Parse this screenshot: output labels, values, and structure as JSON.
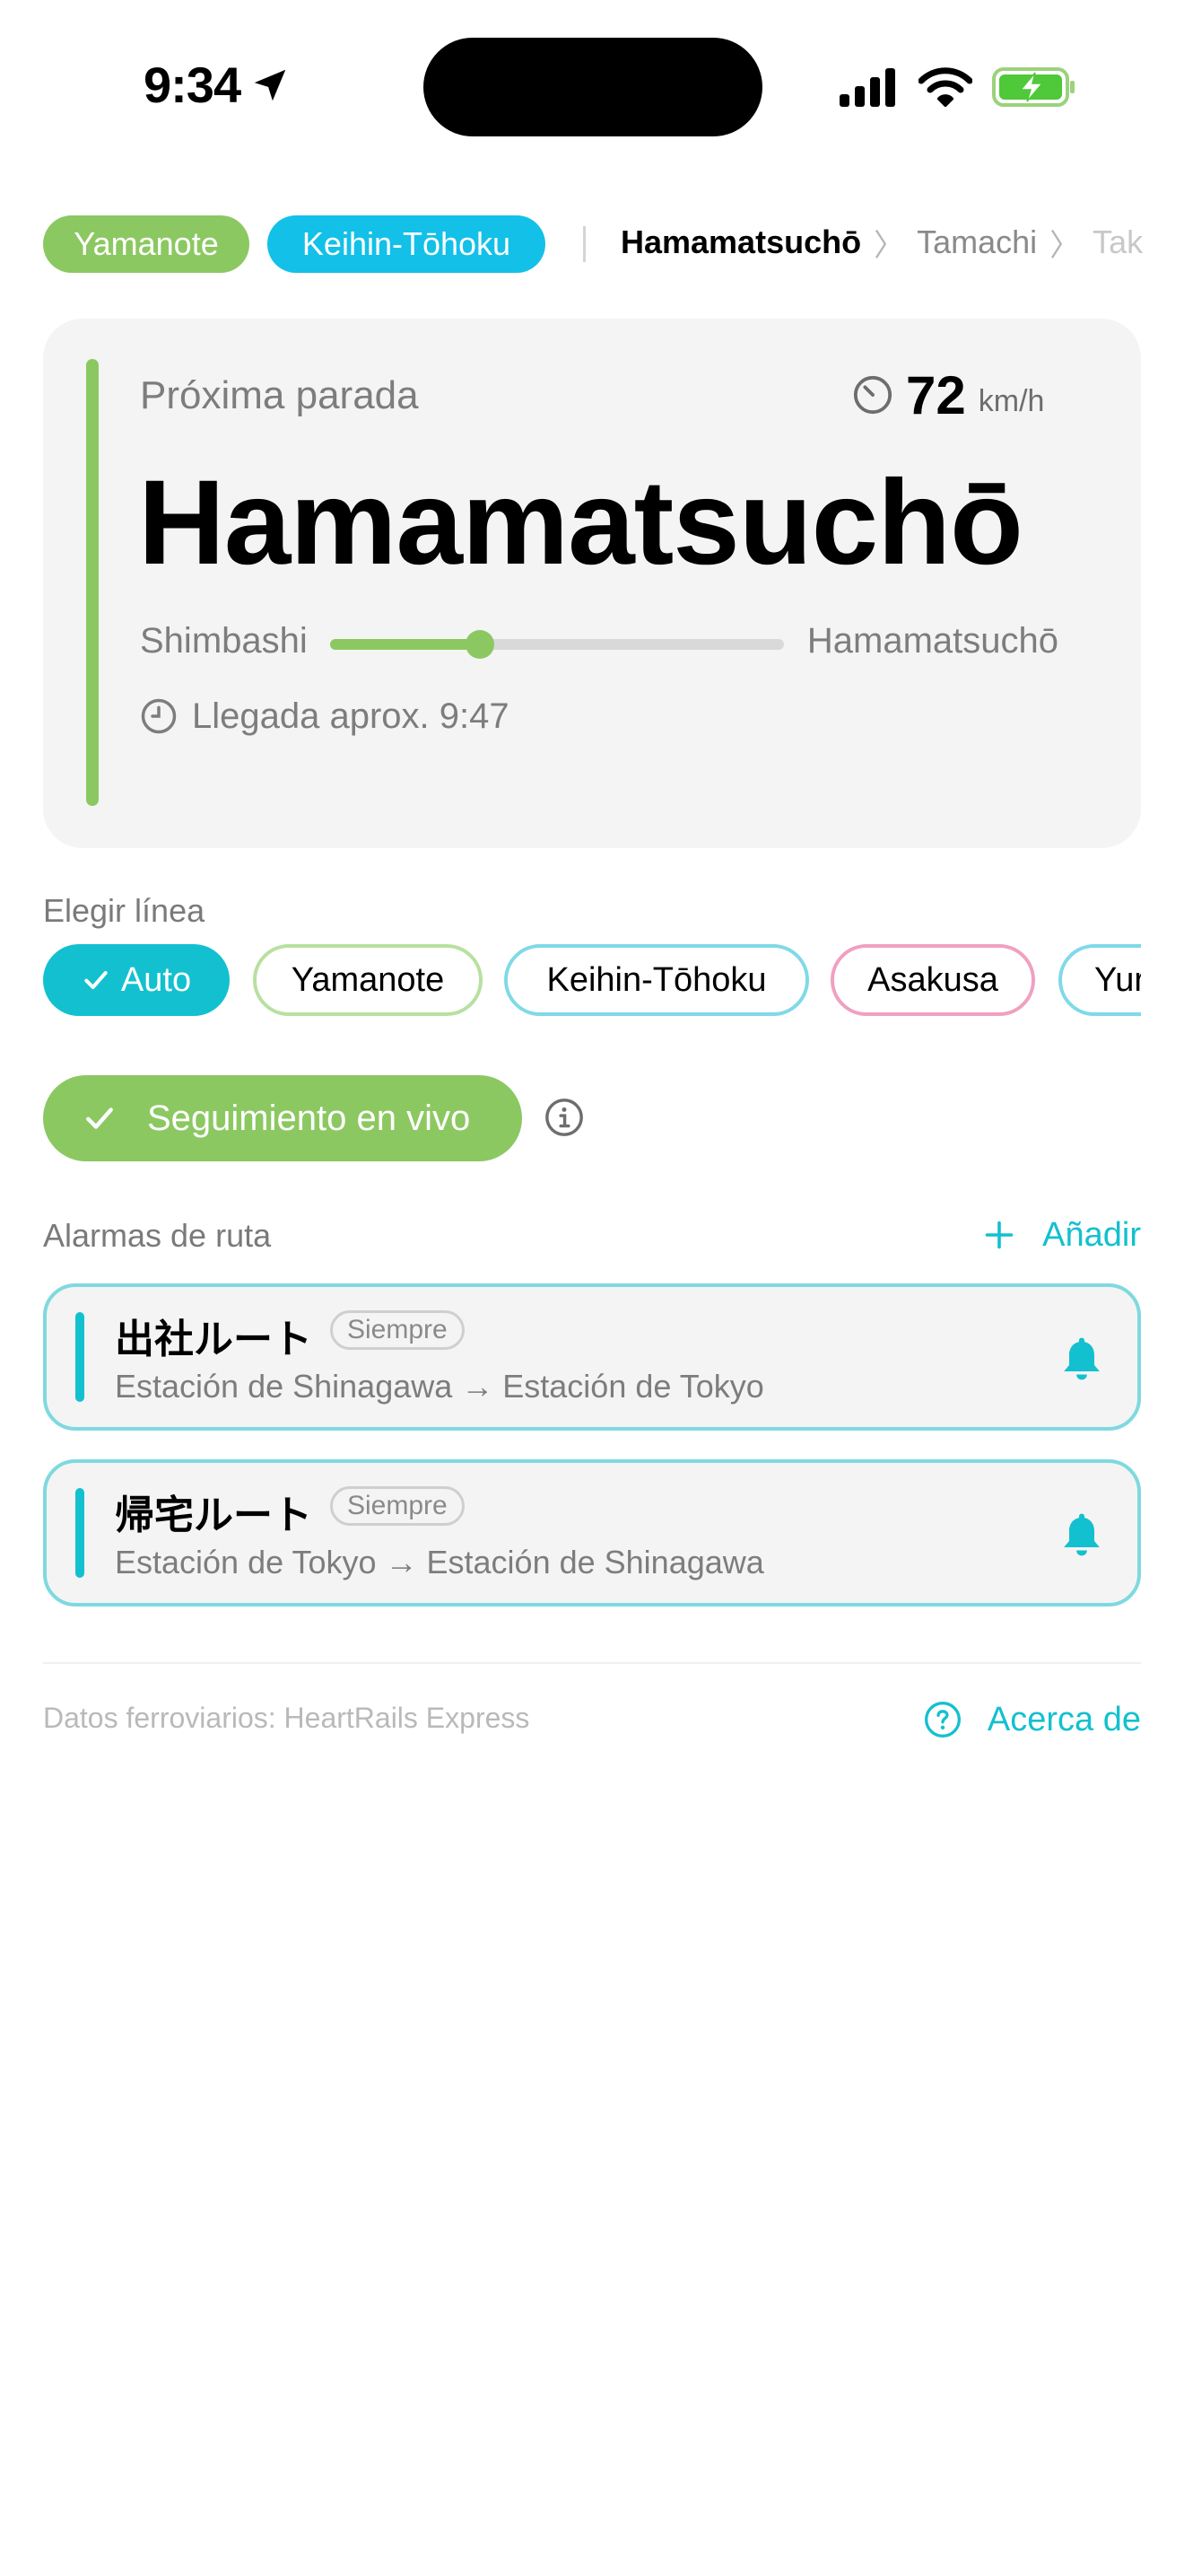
{
  "status_bar": {
    "time": "9:34",
    "icons": [
      "location-arrow-icon",
      "cellular-signal-icon",
      "wifi-icon",
      "battery-charging-icon"
    ]
  },
  "top_lines": [
    {
      "label": "Yamanote",
      "color": "#8cc861"
    },
    {
      "label": "Keihin-Tōhoku",
      "color": "#13c0e8"
    }
  ],
  "breadcrumb": {
    "current": "Hamamatsuchō",
    "next": [
      "Tamachi",
      "Taka"
    ]
  },
  "next_stop": {
    "label": "Próxima parada",
    "station": "Hamamatsuchō",
    "speed_value": "72",
    "speed_unit": "km/h",
    "from": "Shimbashi",
    "to": "Hamamatsuchō",
    "progress": 0.33,
    "eta": "Llegada aprox. 9:47",
    "accent_color": "#8cc861"
  },
  "line_picker": {
    "label": "Elegir línea",
    "options": [
      {
        "label": "Auto",
        "selected": true,
        "color": "#13c0cf"
      },
      {
        "label": "Yamanote",
        "selected": false,
        "color": "#b8e0a0"
      },
      {
        "label": "Keihin-Tōhoku",
        "selected": false,
        "color": "#7fd9e8"
      },
      {
        "label": "Asakusa",
        "selected": false,
        "color": "#f0a0c0"
      },
      {
        "label": "Yur",
        "selected": false,
        "color": "#7fd9e8"
      }
    ]
  },
  "live_tracking": {
    "label": "Seguimiento en vivo",
    "enabled": true
  },
  "alarms": {
    "label": "Alarmas de ruta",
    "add_label": "Añadir",
    "items": [
      {
        "title": "出社ルート",
        "badge": "Siempre",
        "route": "Estación de Shinagawa → Estación de Tokyo"
      },
      {
        "title": "帰宅ルート",
        "badge": "Siempre",
        "route": "Estación de Tokyo → Estación de Shinagawa"
      }
    ]
  },
  "footer": {
    "source_label": "Datos ferroviarios:",
    "source_name": "HeartRails Express",
    "about_label": "Acerca de"
  },
  "colors": {
    "accent": "#13c0cf",
    "green": "#8cc861"
  }
}
